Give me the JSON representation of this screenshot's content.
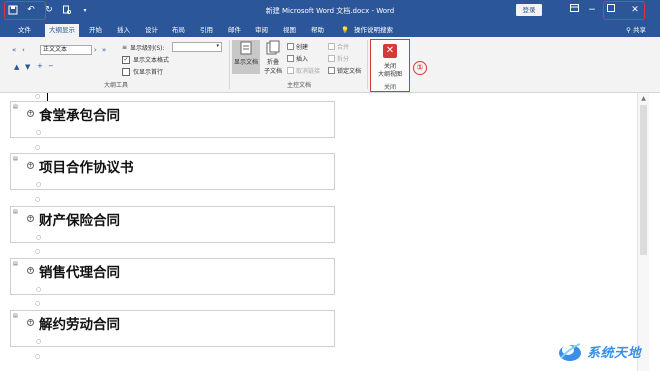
{
  "title_bar": {
    "document_title": "新建 Microsoft Word 文档.docx - Word",
    "login_label": "登录",
    "qat": [
      "save-icon",
      "undo-icon",
      "redo-icon",
      "print-preview-icon"
    ],
    "qat_more": "▾"
  },
  "tabs": [
    {
      "label": "文件"
    },
    {
      "label": "大纲显示",
      "active": true
    },
    {
      "label": "开始"
    },
    {
      "label": "插入"
    },
    {
      "label": "设计"
    },
    {
      "label": "布局"
    },
    {
      "label": "引用"
    },
    {
      "label": "邮件"
    },
    {
      "label": "审阅"
    },
    {
      "label": "视图"
    },
    {
      "label": "帮助"
    },
    {
      "label": "操作说明搜索"
    }
  ],
  "share_label": "共享",
  "ribbon": {
    "outline_tools": {
      "level_value": "正文文本",
      "show_level_label": "显示级别(S):",
      "show_text_format_label": "显示文本格式",
      "show_first_line_only_label": "仅显示首行",
      "show_text_format_checked": true,
      "show_first_line_only_checked": false,
      "group_label": "大纲工具"
    },
    "master_document": {
      "show_document_label": "显示文档",
      "collapse_label": "折叠\n子文档",
      "create_label": "创建",
      "insert_label": "插入",
      "unlink_label": "取消链接",
      "merge_label": "合并",
      "split_label": "拆分",
      "lock_label": "锁定文档",
      "group_label": "主控文档"
    },
    "close": {
      "button_label_line1": "关闭",
      "button_label_line2": "大纲视图",
      "group_label": "关闭",
      "step_marker": "①"
    }
  },
  "document": {
    "headings": [
      {
        "text": "食堂承包合同"
      },
      {
        "text": "项目合作协议书"
      },
      {
        "text": "财产保险合同"
      },
      {
        "text": "销售代理合同"
      },
      {
        "text": "解约劳动合同"
      }
    ]
  },
  "watermark": {
    "text": "系统天地"
  }
}
